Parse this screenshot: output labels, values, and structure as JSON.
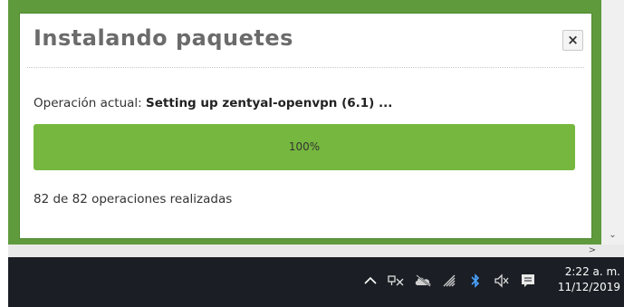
{
  "dialog": {
    "title": "Instalando paquetes",
    "close_label": "×",
    "current_operation_label": "Operación actual:",
    "current_operation_value": "Setting up zentyal-openvpn (6.1) ...",
    "progress_fraction": 1.0,
    "progress_label": "100%",
    "operations_done": "82 de 82 operaciones realizadas"
  },
  "scrollbar": {
    "down_arrow": "⌄",
    "right_arrow": ">"
  },
  "taskbar": {
    "tray_icons": [
      "chevron-up-icon",
      "network-icon",
      "onedrive-icon",
      "wifi-icon",
      "bluetooth-icon",
      "volume-muted-icon",
      "notification-icon"
    ],
    "clock_time": "2:22 a. m.",
    "clock_date": "11/12/2019"
  },
  "colors": {
    "page_green": "#5f9a3d",
    "progress_green": "#76b83f",
    "taskbar": "#1b1e24"
  }
}
